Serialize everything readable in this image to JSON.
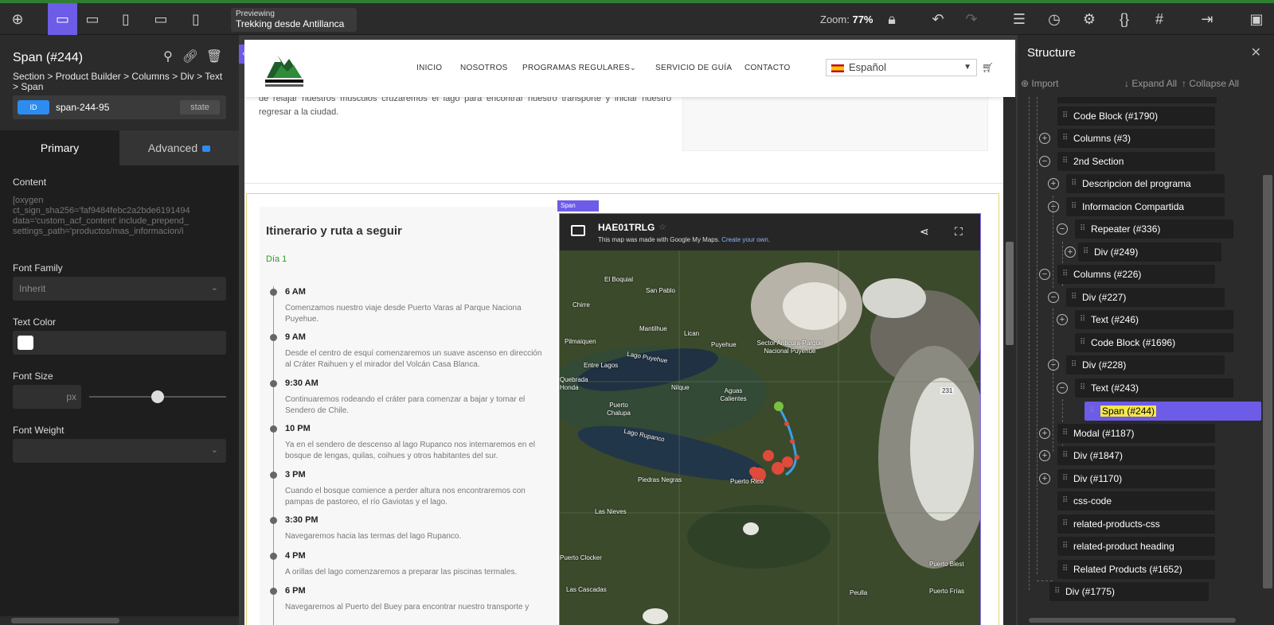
{
  "topbar": {
    "preview_label": "Previewing",
    "preview_value": "Trekking desde Antillanca",
    "zoom_label": "Zoom:",
    "zoom_value": "77%"
  },
  "left_panel": {
    "title": "Span (#244)",
    "breadcrumb": "Section > Product Builder > Columns > Div > Text > Span",
    "id_badge": "ID",
    "id_value": "span-244-95",
    "state_label": "state",
    "tab_primary": "Primary",
    "tab_advanced": "Advanced",
    "content_label": "Content",
    "content_value": "[oxygen\nct_sign_sha256='faf9484febc2a2bde6191494\ndata='custom_acf_content' include_prepend_\nsettings_path='productos/mas_informacion/i",
    "font_family_label": "Font Family",
    "font_family_value": "Inherit",
    "text_color_label": "Text Color",
    "text_color_value": "#ffffff",
    "font_size_label": "Font Size",
    "font_size_unit": "px",
    "font_size_slider_fraction": 0.5,
    "font_weight_label": "Font Weight"
  },
  "site": {
    "nav": [
      "INICIO",
      "NOSOTROS",
      "PROGRAMAS REGULARES",
      "SERVICIO DE GUÍA",
      "CONTACTO"
    ],
    "language": "Español",
    "intro_text": "de relajar nuestros músculos cruzaremos el lago para encontrar nuestro transporte y iniciar nuestro regresar a la ciudad.",
    "itinerary_title": "Itinerario y ruta a seguir",
    "day_label": "Día 1",
    "events": [
      {
        "time": "6 AM",
        "desc": "Comenzamos nuestro viaje desde Puerto Varas al Parque Naciona Puyehue."
      },
      {
        "time": "9 AM",
        "desc": "Desde el centro de esquí comenzaremos un suave ascenso en dirección al Cráter Raihuen y el mirador del Volcán Casa Blanca."
      },
      {
        "time": "9:30 AM",
        "desc": "Continuaremos rodeando el cráter para comenzar a bajar y tomar el Sendero de Chile."
      },
      {
        "time": "10 PM",
        "desc": "Ya en el sendero de descenso al lago Rupanco nos internaremos en el bosque de lengas, quilas, coihues y otros habitantes del sur."
      },
      {
        "time": "3 PM",
        "desc": "Cuando el bosque comience a perder altura nos encontraremos con pampas de pastoreo, el río Gaviotas y el lago."
      },
      {
        "time": "3:30 PM",
        "desc": "Navegaremos hacia las termas del lago Rupanco."
      },
      {
        "time": "4 PM",
        "desc": "A orillas del lago comenzaremos a preparar las piscinas termales."
      },
      {
        "time": "6 PM",
        "desc": "Navegaremos al Puerto del Buey para encontrar nuestro transporte y"
      }
    ],
    "map": {
      "tag": "Span",
      "title": "HAE01TRLG",
      "subtitle": "This map was made with Google My Maps.",
      "subtitle_link": "Create your own.",
      "places": [
        "El Boquial",
        "San Pablo",
        "Chirre",
        "Mantilhue",
        "Lican",
        "Pilmaiquen",
        "Puyehue",
        "Sector Anticura-Parque Nacional Puyehue",
        "Lago Puyehue",
        "Entre Lagos",
        "Quebrada Honda",
        "Nilque",
        "Aguas Calientes",
        "Puerto Chalupa",
        "Lago Rupanco",
        "Piedras Negras",
        "Puerto Rico",
        "Las Nieves",
        "Puerto Clocker",
        "Las Cascadas",
        "Peulla",
        "Puerto Blest",
        "Puerto Frías",
        "231"
      ]
    }
  },
  "structure": {
    "title": "Structure",
    "import": "Import",
    "expand_all": "Expand All",
    "collapse_all": "Collapse All",
    "nodes": [
      {
        "label": "Code Block (#1790)"
      },
      {
        "label": "Columns (#3)"
      },
      {
        "label": "2nd Section"
      },
      {
        "label": "Descripcion del programa"
      },
      {
        "label": "Informacion Compartida"
      },
      {
        "label": "Repeater (#336)"
      },
      {
        "label": "Div (#249)"
      },
      {
        "label": "Columns (#226)"
      },
      {
        "label": "Div (#227)"
      },
      {
        "label": "Text (#246)"
      },
      {
        "label": "Code Block (#1696)"
      },
      {
        "label": "Div (#228)"
      },
      {
        "label": "Text (#243)"
      },
      {
        "label": "Span (#244)"
      },
      {
        "label": "Modal (#1187)"
      },
      {
        "label": "Div (#1847)"
      },
      {
        "label": "Div (#1170)"
      },
      {
        "label": "css-code"
      },
      {
        "label": "related-products-css"
      },
      {
        "label": "related-product heading"
      },
      {
        "label": "Related Products (#1652)"
      },
      {
        "label": "Div (#1775)"
      }
    ]
  }
}
